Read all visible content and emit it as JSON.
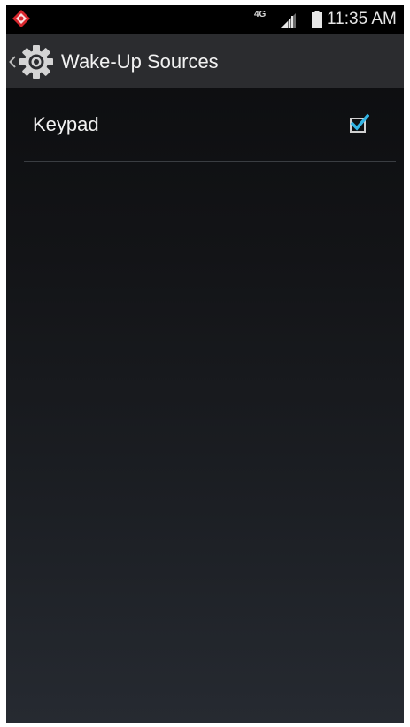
{
  "status_bar": {
    "network_type": "4G",
    "time": "11:35 AM",
    "icons": [
      "carrier-logo-icon",
      "signal-icon",
      "battery-icon"
    ]
  },
  "action_bar": {
    "title": "Wake-Up Sources",
    "icons": [
      "chevron-left-icon",
      "gear-icon"
    ]
  },
  "preferences": [
    {
      "label": "Keypad",
      "checked": true
    }
  ],
  "colors": {
    "accent": "#33b5e5",
    "action_bar_bg": "#2b2c2f",
    "status_bar_bg": "#000000",
    "text": "#f2f2f2"
  }
}
